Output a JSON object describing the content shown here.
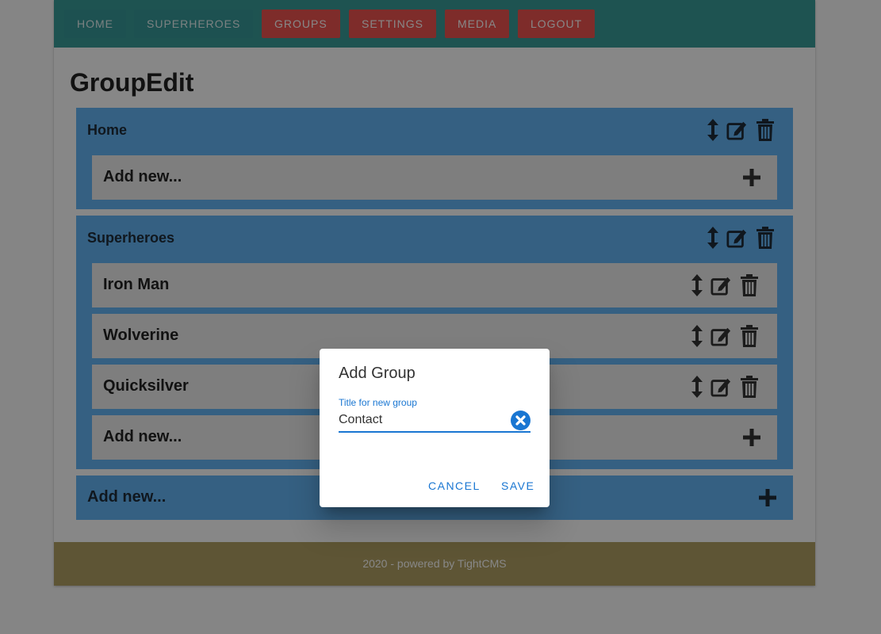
{
  "nav": {
    "items": [
      {
        "label": "HOME",
        "style": "teal"
      },
      {
        "label": "SUPERHEROES",
        "style": "teal"
      },
      {
        "label": "GROUPS",
        "style": "red"
      },
      {
        "label": "SETTINGS",
        "style": "red"
      },
      {
        "label": "MEDIA",
        "style": "red"
      },
      {
        "label": "LOGOUT",
        "style": "red"
      }
    ]
  },
  "page": {
    "title": "GroupEdit"
  },
  "groups": [
    {
      "title": "Home",
      "items": [],
      "add_label": "Add new..."
    },
    {
      "title": "Superheroes",
      "items": [
        {
          "label": "Iron Man"
        },
        {
          "label": "Wolverine"
        },
        {
          "label": "Quicksilver"
        }
      ],
      "add_label": "Add new..."
    }
  ],
  "add_group_label": "Add new...",
  "footer": {
    "text": "2020 - powered by TightCMS"
  },
  "dialog": {
    "title": "Add Group",
    "field_label": "Title for new group",
    "field_value": "Contact",
    "cancel_label": "CANCEL",
    "save_label": "SAVE"
  },
  "icons": {
    "move": "arrows-vertical-icon",
    "edit": "edit-icon",
    "delete": "trash-icon",
    "add": "plus-icon",
    "clear": "close-circle-icon"
  },
  "colors": {
    "navbar": "#3a9d99",
    "nav_teal_button": "#38999a",
    "nav_red_button": "#ef5350",
    "group_bg": "#64b5f6",
    "item_bg": "#eeeeee",
    "footer": "#b2a164",
    "accent": "#1976d2"
  }
}
